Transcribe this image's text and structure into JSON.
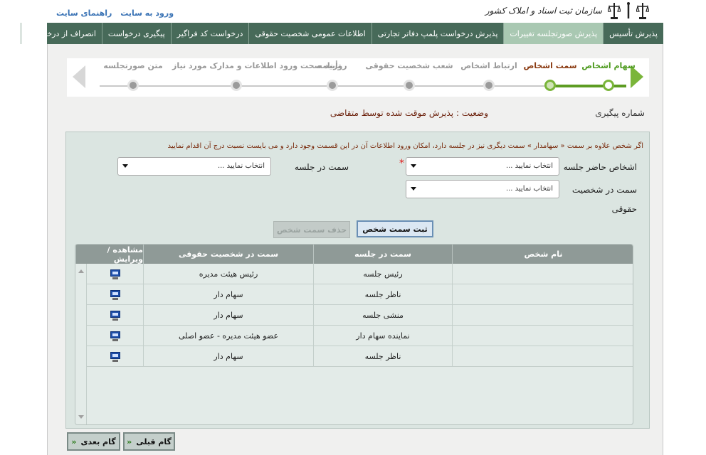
{
  "header": {
    "links": [
      "ورود به سایت",
      "راهنمای سایت"
    ],
    "logo_text": "سازمان ثبت اسناد و املاک کشور",
    "logo_icon": "scales-of-justice-icon"
  },
  "menu": {
    "items": [
      {
        "label": "پذیرش تأسیس",
        "active": false
      },
      {
        "label": "پذیرش صورتجلسه تغییرات",
        "active": true
      },
      {
        "label": "پذیرش درخواست پلمپ دفاتر تجارتی",
        "active": false
      },
      {
        "label": "اطلاعات عمومی شخصیت حقوقی",
        "active": false
      },
      {
        "label": "درخواست کد فراگیر",
        "active": false
      },
      {
        "label": "پیگیری درخواست",
        "active": false
      },
      {
        "label": "انصراف از درخواست",
        "active": false
      }
    ]
  },
  "wizard": {
    "steps": [
      {
        "label": "سهام اشخاص",
        "state": "done"
      },
      {
        "label": "سمت اشخاص",
        "state": "current"
      },
      {
        "label": "ارتباط اشخاص",
        "state": "pending"
      },
      {
        "label": "شعب شخصیت حقوقی",
        "state": "pending"
      },
      {
        "label": "روزنامه",
        "state": "pending"
      },
      {
        "label": "تأیید صحت ورود اطلاعات و مدارک مورد نیاز",
        "state": "pending"
      },
      {
        "label": "متن صورتجلسه",
        "state": "pending"
      }
    ]
  },
  "status": {
    "tracking_label": "شماره پیگیری",
    "status_text": "وضعیت : پذیرش موقت شده توسط متقاضی"
  },
  "form": {
    "note": "اگر شخص علاوه بر سمت « سهامدار » سمت دیگری نیز در جلسه دارد، امکان ورود اطلاعات آن در این قسمت وجود دارد و می بایست نسبت درج آن اقدام نمایید",
    "present_persons_label": "اشخاص حاضر جلسه",
    "present_persons_value": "انتخاب نمایید ...",
    "meeting_role_label": "سمت در جلسه",
    "meeting_role_value": "انتخاب نمایید ...",
    "legal_role_label_1": "سمت در شخصیت",
    "legal_role_label_2": "حقوقی",
    "legal_role_value": "انتخاب نمایید ...",
    "required_mark": "*",
    "submit_label": "ثبت سمت شخص",
    "delete_label": "حذف سمت شخص"
  },
  "table": {
    "headers": [
      "نام شخص",
      "سمت در جلسه",
      "سمت در شخصیت حقوقی",
      "مشاهده / ویرایش"
    ],
    "rows": [
      {
        "name": "",
        "meeting_role": "رئیس جلسه",
        "legal_role": "رئیس هیئت مدیره"
      },
      {
        "name": "",
        "meeting_role": "ناظر جلسه",
        "legal_role": "سهام دار"
      },
      {
        "name": "",
        "meeting_role": "منشی جلسه",
        "legal_role": "سهام دار"
      },
      {
        "name": "",
        "meeting_role": "نماینده سهام دار",
        "legal_role": "عضو هیئت مدیره - عضو اصلی"
      },
      {
        "name": "",
        "meeting_role": "ناظر جلسه",
        "legal_role": "سهام دار"
      }
    ],
    "edit_icon": "monitor-edit-icon"
  },
  "footer": {
    "prev_label": "گام قبلی",
    "next_label": "گام بعدی"
  },
  "colors": {
    "menu_bg": "#476a59",
    "menu_active": "#a9c8b2",
    "wizard_done": "#7ab53a",
    "wizard_current_text": "#8a3a11",
    "table_header": "#8f9a97"
  }
}
